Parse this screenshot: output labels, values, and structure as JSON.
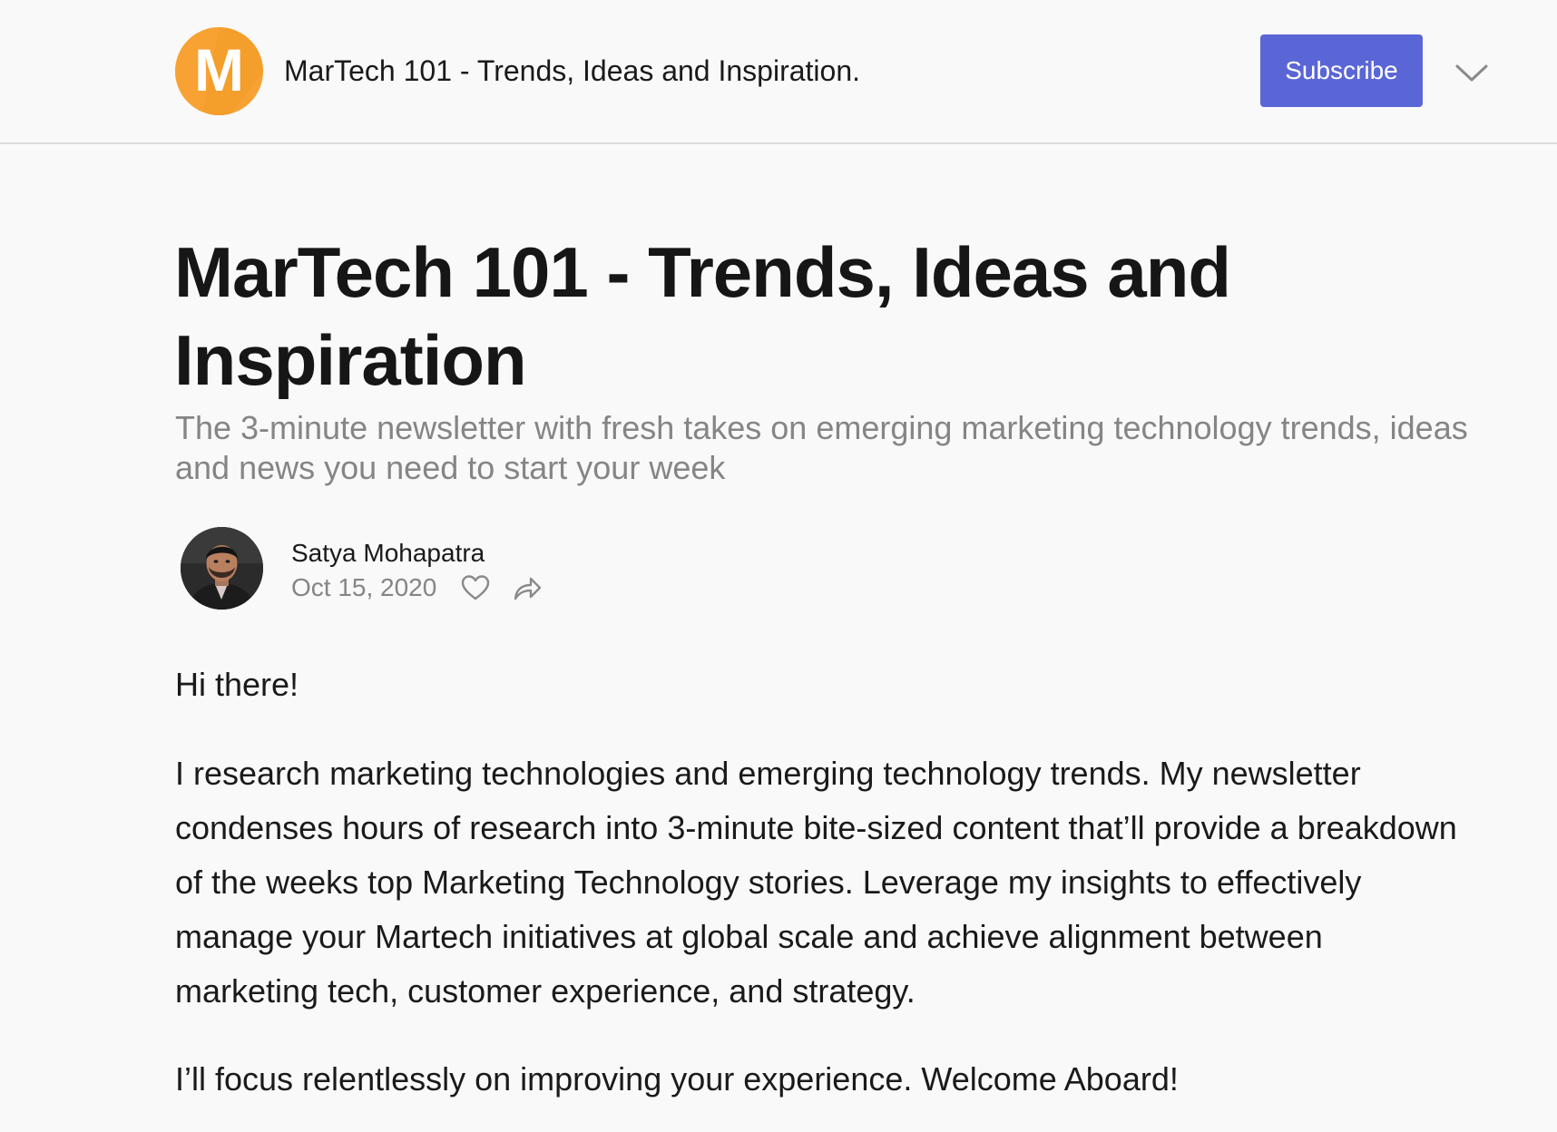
{
  "header": {
    "logo_letter": "M",
    "publication_name": "MarTech 101 - Trends, Ideas and Inspiration.",
    "subscribe_label": "Subscribe",
    "menu_icon": "chevron-down-icon",
    "brand_color": "#f7a233",
    "button_color": "#5a66d6"
  },
  "post": {
    "title": "MarTech 101 - Trends, Ideas and Inspiration",
    "subtitle": "The 3-minute newsletter with fresh takes on emerging marketing technology trends, ideas and news you need to start your week",
    "author": "Satya Mohapatra",
    "date": "Oct 15, 2020",
    "like_icon": "heart-icon",
    "share_icon": "share-icon",
    "paragraphs": [
      "Hi there!",
      "I research marketing technologies and emerging technology trends. My newsletter condenses hours of research into 3-minute bite-sized content that’ll provide a breakdown of the weeks top Marketing Technology stories. Leverage my insights to effectively manage your Martech initiatives at global scale and achieve alignment between marketing tech, customer experience, and strategy.",
      "I’ll focus relentlessly on improving your experience. Welcome Aboard!"
    ]
  }
}
